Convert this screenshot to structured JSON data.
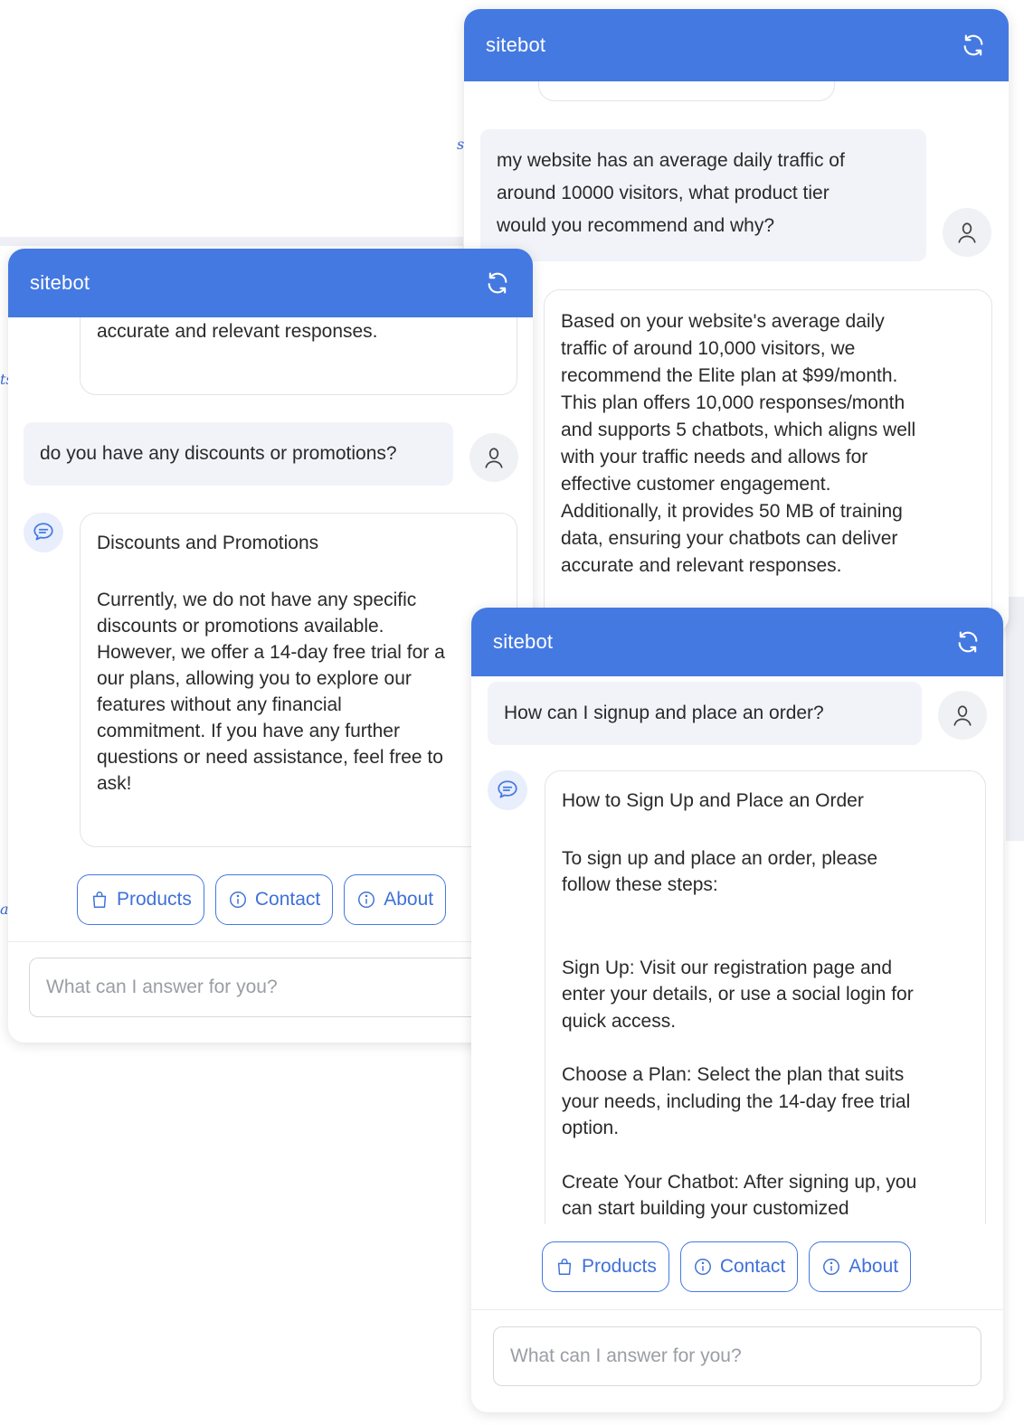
{
  "app": {
    "title": "sitebot"
  },
  "colors": {
    "header": "#4479e2",
    "accent": "#3f71d9",
    "user_bubble": "#f1f3f9"
  },
  "windows": {
    "top_right": {
      "title": "sitebot",
      "user_message": [
        "my website has an average daily traffic of",
        "around 10000 visitors, what product tier",
        "would you recommend and why?"
      ],
      "bot_message": [
        "Based on your website's average daily",
        "traffic of around 10,000 visitors, we",
        "recommend the Elite plan at $99/month.",
        "This plan offers 10,000 responses/month",
        "and supports 5 chatbots, which aligns well",
        "with your traffic needs and allows for",
        "effective customer engagement.",
        "Additionally, it provides 50 MB of training",
        "data, ensuring your chatbots can deliver",
        "accurate and relevant responses."
      ]
    },
    "left": {
      "title": "sitebot",
      "prev_bot_tail": "accurate and relevant responses.",
      "user_message": "do you have any discounts or promotions?",
      "bot_heading": "Discounts and Promotions",
      "bot_message": [
        "Currently, we do not have any specific",
        "discounts or promotions available.",
        "However, we offer a 14-day free trial for a",
        "our plans, allowing you to explore our",
        "features without any financial",
        "commitment. If you have any further",
        "questions or need assistance, feel free to",
        "ask!"
      ],
      "quick_replies": [
        "Products",
        "Contact",
        "About"
      ],
      "input_placeholder": "What can I answer for you?"
    },
    "bottom_right": {
      "title": "sitebot",
      "user_message": "How can I signup and place an order?",
      "bot_heading": "How to Sign Up and Place an Order",
      "bot_intro": [
        "To sign up and place an order, please",
        "follow these steps:"
      ],
      "steps": [
        [
          "Sign Up: Visit our registration page and",
          "enter your details, or use a social login for",
          "quick access."
        ],
        [
          "Choose a Plan: Select the plan that suits",
          "your needs, including the 14-day free trial",
          "option."
        ],
        [
          "Create Your Chatbot: After signing up, you",
          "can start building your customized"
        ]
      ],
      "quick_replies": [
        "Products",
        "Contact",
        "About"
      ],
      "input_placeholder": "What can I answer for you?"
    }
  },
  "icons": [
    "refresh-icon",
    "user-icon",
    "chat-bubble-icon",
    "shopping-bag-icon",
    "info-icon"
  ]
}
